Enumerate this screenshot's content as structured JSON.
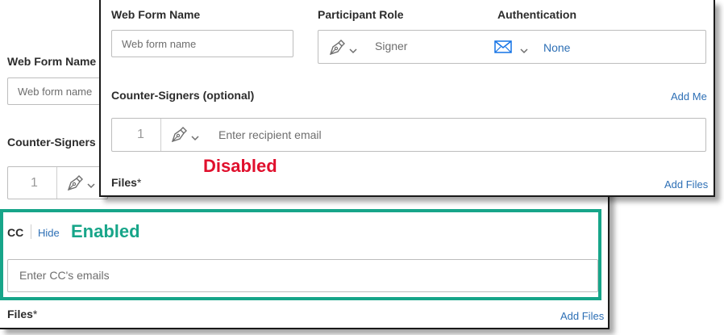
{
  "back": {
    "web_form_name_label": "Web Form Name",
    "web_form_name_placeholder": "Web form name",
    "counter_signers_label": "Counter-Signers (",
    "recipient_index": "1",
    "cc_label": "CC",
    "cc_hide_link": "Hide",
    "cc_status_label": "Enabled",
    "cc_placeholder": "Enter CC's emails",
    "files_label": "Files",
    "files_required_mark": "*",
    "add_files_link": "Add Files"
  },
  "front": {
    "web_form_name_label": "Web Form Name",
    "web_form_name_placeholder": "Web form name",
    "participant_role_label": "Participant Role",
    "participant_role_value": "Signer",
    "authentication_label": "Authentication",
    "authentication_value": "None",
    "counter_signers_label": "Counter-Signers (optional)",
    "add_me_link": "Add Me",
    "recipient_index": "1",
    "recipient_placeholder": "Enter recipient email",
    "disabled_status_label": "Disabled",
    "files_label": "Files",
    "files_required_mark": "*",
    "add_files_link": "Add Files"
  },
  "icons": {
    "signer": "pen-nib-icon",
    "dropdown": "chevron-down-icon",
    "email_auth": "envelope-icon"
  },
  "colors": {
    "link": "#1473e6",
    "disabled_text": "#e0102d",
    "enabled_accent": "#17a589"
  }
}
